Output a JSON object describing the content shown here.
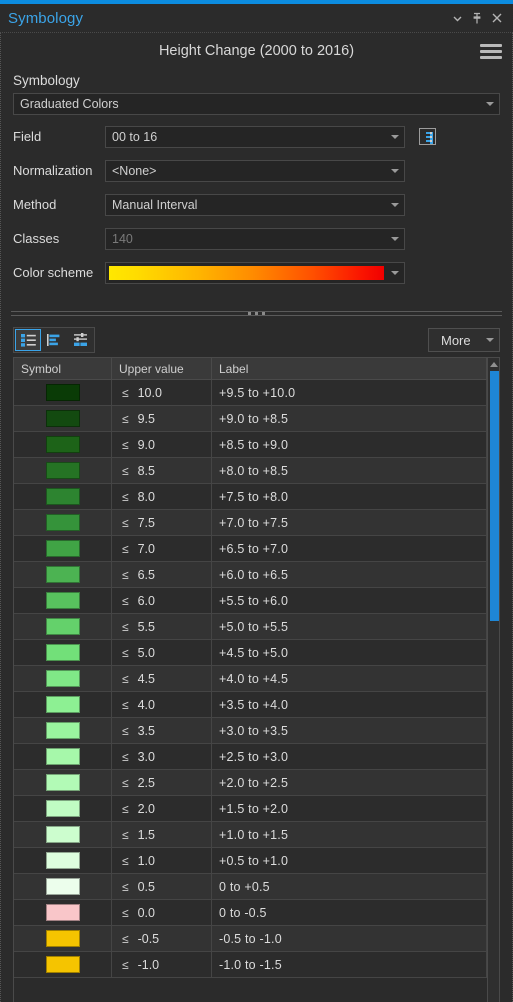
{
  "titlebar": {
    "title": "Symbology",
    "dropdown_icon": "chevron-down-icon",
    "pin_icon": "pin-icon",
    "close_icon": "close-icon"
  },
  "header": {
    "title": "Height Change (2000 to 2016)",
    "menu_icon": "hamburger-menu-icon"
  },
  "symbology": {
    "label": "Symbology",
    "value": "Graduated Colors"
  },
  "form": {
    "rows": [
      {
        "label": "Field",
        "value": "00 to 16",
        "disabled": false,
        "extra_icon": "field-list-icon"
      },
      {
        "label": "Normalization",
        "value": "<None>",
        "disabled": false
      },
      {
        "label": "Method",
        "value": "Manual Interval",
        "disabled": false
      },
      {
        "label": "Classes",
        "value": "140",
        "disabled": true
      }
    ],
    "color_scheme_label": "Color scheme",
    "color_scheme_stops": [
      "#ffe800",
      "#ffb400",
      "#ff8c00",
      "#ff5000",
      "#f00000"
    ]
  },
  "toolbar": {
    "view_buttons": [
      {
        "name": "list-view-icon",
        "active": true
      },
      {
        "name": "histogram-view-icon",
        "active": false
      },
      {
        "name": "slider-view-icon",
        "active": false
      }
    ],
    "more_label": "More"
  },
  "table": {
    "columns": [
      "Symbol",
      "Upper value",
      "Label"
    ],
    "operator": "≤",
    "rows": [
      {
        "color": "#0a3b06",
        "upper": "10.0",
        "label": "+9.5  to +10.0"
      },
      {
        "color": "#134a10",
        "upper": "9.5",
        "label": "+9.0  to +8.5"
      },
      {
        "color": "#1d6318",
        "upper": "9.0",
        "label": "+8.5  to +9.0"
      },
      {
        "color": "#257324",
        "upper": "8.5",
        "label": "+8.0  to +8.5"
      },
      {
        "color": "#2d8430",
        "upper": "8.0",
        "label": "+7.5  to +8.0"
      },
      {
        "color": "#35933a",
        "upper": "7.5",
        "label": "+7.0  to +7.5"
      },
      {
        "color": "#40a445",
        "upper": "7.0",
        "label": "+6.5  to +7.0"
      },
      {
        "color": "#4cb352",
        "upper": "6.5",
        "label": "+6.0  to +6.5"
      },
      {
        "color": "#58c25e",
        "upper": "6.0",
        "label": "+5.5  to +6.0"
      },
      {
        "color": "#64d16b",
        "upper": "5.5",
        "label": "+5.0  to +5.5"
      },
      {
        "color": "#72e079",
        "upper": "5.0",
        "label": "+4.5  to +5.0"
      },
      {
        "color": "#80e887",
        "upper": "4.5",
        "label": "+4.0  to +4.5"
      },
      {
        "color": "#8df093",
        "upper": "4.0",
        "label": "+3.5  to +4.0"
      },
      {
        "color": "#9af59f",
        "upper": "3.5",
        "label": "+3.0  to +3.5"
      },
      {
        "color": "#a6f8aa",
        "upper": "3.0",
        "label": "+2.5  to +3.0"
      },
      {
        "color": "#b2fab6",
        "upper": "2.5",
        "label": "+2.0  to +2.5"
      },
      {
        "color": "#c0fcc3",
        "upper": "2.0",
        "label": "+1.5  to +2.0"
      },
      {
        "color": "#ccfdce",
        "upper": "1.5",
        "label": "+1.0  to +1.5"
      },
      {
        "color": "#ddfede",
        "upper": "1.0",
        "label": "+0.5  to +1.0"
      },
      {
        "color": "#ecfeec",
        "upper": "0.5",
        "label": "0  to +0.5"
      },
      {
        "color": "#f9c6c9",
        "upper": "0.0",
        "label": "0  to -0.5"
      },
      {
        "color": "#f5c400",
        "upper": "-0.5",
        "label": "-0.5  to -1.0"
      },
      {
        "color": "#f5c400",
        "upper": "-1.0",
        "label": "-1.0  to -1.5"
      }
    ]
  },
  "colors": {
    "accent": "#0c8ce0",
    "title_text": "#3ba4e8",
    "panel_bg": "#2b2b2b",
    "scrollbar_thumb": "#1e86d6"
  }
}
